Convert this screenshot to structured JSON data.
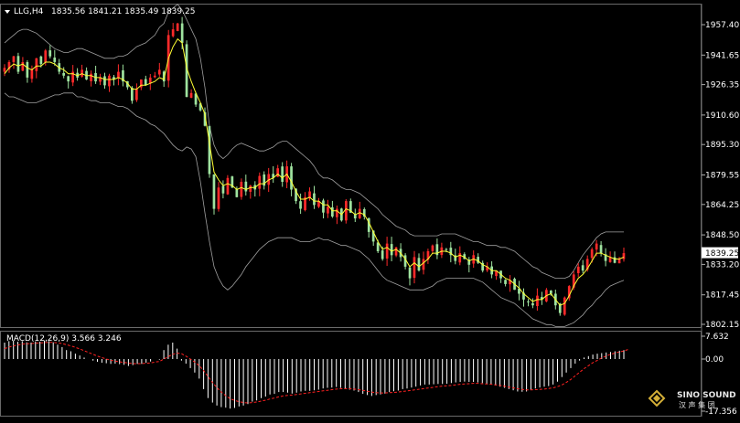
{
  "header": {
    "symbol": "LLG,H4",
    "ohlc": "1835.56 1841.21 1835.49 1839.25"
  },
  "macd_header": "MACD(12,26,9) 3.566 3.246",
  "watermark": {
    "brand": "SINO SOUND",
    "sub": "汉 声 集 团"
  },
  "colors": {
    "background": "#000000",
    "up_candle": "#ff2a2a",
    "down_candle": "#9fe39f",
    "ma_line": "#ffff33",
    "bollinger": "#a0a0a0",
    "macd_hist": "#ffffff",
    "signal_line": "#ff2020",
    "price_tag_bg": "#ffffff"
  },
  "chart_data": [
    {
      "type": "candlestick",
      "title": "LLG,H4",
      "ylim": [
        1802.15,
        1965
      ],
      "y_ticks": [
        "1957.40",
        "1941.65",
        "1926.35",
        "1910.60",
        "1895.30",
        "1879.55",
        "1864.25",
        "1848.50",
        "1833.20",
        "1817.45",
        "1802.15"
      ],
      "tick_values": [
        1957.4,
        1941.65,
        1926.35,
        1910.6,
        1895.3,
        1879.55,
        1864.25,
        1848.5,
        1833.2,
        1817.45,
        1802.15
      ],
      "current_price_label": "1839.25",
      "current_price": 1839.25,
      "close": [
        1935,
        1938,
        1941,
        1933,
        1938,
        1930,
        1934,
        1940,
        1937,
        1944,
        1941,
        1938,
        1933,
        1931,
        1928,
        1933,
        1930,
        1934,
        1929,
        1932,
        1928,
        1930,
        1926,
        1931,
        1929,
        1933,
        1928,
        1925,
        1918,
        1924,
        1929,
        1926,
        1930,
        1931,
        1934,
        1928,
        1952,
        1955,
        1958,
        1948,
        1920,
        1922,
        1916,
        1913,
        1905,
        1880,
        1862,
        1873,
        1870,
        1878,
        1873,
        1868,
        1876,
        1871,
        1874,
        1872,
        1879,
        1874,
        1880,
        1878,
        1883,
        1876,
        1884,
        1872,
        1866,
        1862,
        1868,
        1871,
        1864,
        1866,
        1860,
        1863,
        1858,
        1862,
        1856,
        1866,
        1860,
        1857,
        1862,
        1858,
        1850,
        1845,
        1840,
        1836,
        1844,
        1838,
        1842,
        1837,
        1832,
        1826,
        1837,
        1830,
        1836,
        1840,
        1843,
        1838,
        1842,
        1841,
        1838,
        1835,
        1839,
        1836,
        1833,
        1838,
        1834,
        1830,
        1832,
        1828,
        1830,
        1826,
        1823,
        1825,
        1820,
        1818,
        1815,
        1814,
        1812,
        1817,
        1815,
        1820,
        1818,
        1812,
        1808,
        1816,
        1822,
        1828,
        1832,
        1830,
        1836,
        1841,
        1844,
        1839,
        1835,
        1837,
        1834,
        1836,
        1839
      ],
      "ma_line": [
        1932,
        1935,
        1937,
        1936,
        1937,
        1935,
        1934,
        1936,
        1936,
        1938,
        1938,
        1937,
        1935,
        1934,
        1932,
        1932,
        1931,
        1932,
        1931,
        1931,
        1930,
        1930,
        1929,
        1929,
        1929,
        1930,
        1929,
        1927,
        1924,
        1924,
        1926,
        1926,
        1927,
        1928,
        1930,
        1929,
        1940,
        1946,
        1950,
        1948,
        1935,
        1928,
        1922,
        1917,
        1911,
        1896,
        1881,
        1877,
        1874,
        1875,
        1874,
        1872,
        1873,
        1872,
        1873,
        1873,
        1875,
        1875,
        1877,
        1878,
        1880,
        1878,
        1880,
        1876,
        1871,
        1867,
        1867,
        1868,
        1866,
        1866,
        1864,
        1864,
        1861,
        1861,
        1859,
        1862,
        1861,
        1859,
        1860,
        1859,
        1855,
        1850,
        1845,
        1841,
        1842,
        1840,
        1841,
        1839,
        1836,
        1832,
        1834,
        1832,
        1834,
        1836,
        1839,
        1839,
        1840,
        1840,
        1839,
        1837,
        1838,
        1837,
        1835,
        1836,
        1835,
        1833,
        1832,
        1830,
        1830,
        1828,
        1826,
        1825,
        1823,
        1821,
        1818,
        1816,
        1814,
        1815,
        1815,
        1817,
        1818,
        1815,
        1812,
        1813,
        1817,
        1822,
        1826,
        1828,
        1831,
        1835,
        1839,
        1839,
        1838,
        1837,
        1836,
        1836,
        1837
      ],
      "bb_upper": [
        1948,
        1950,
        1952,
        1954,
        1955,
        1955,
        1954,
        1953,
        1951,
        1949,
        1947,
        1945,
        1944,
        1943,
        1943,
        1944,
        1945,
        1945,
        1944,
        1943,
        1942,
        1941,
        1940,
        1940,
        1940,
        1941,
        1941,
        1942,
        1944,
        1946,
        1947,
        1948,
        1950,
        1952,
        1956,
        1958,
        1964,
        1966,
        1968,
        1965,
        1960,
        1955,
        1950,
        1940,
        1925,
        1905,
        1895,
        1890,
        1888,
        1890,
        1893,
        1895,
        1896,
        1895,
        1894,
        1893,
        1892,
        1892,
        1893,
        1894,
        1896,
        1897,
        1897,
        1895,
        1893,
        1891,
        1889,
        1887,
        1884,
        1880,
        1878,
        1878,
        1877,
        1875,
        1873,
        1872,
        1872,
        1871,
        1870,
        1868,
        1866,
        1864,
        1862,
        1859,
        1857,
        1855,
        1853,
        1852,
        1851,
        1849,
        1848,
        1848,
        1848,
        1848,
        1848,
        1848,
        1849,
        1849,
        1849,
        1849,
        1848,
        1847,
        1846,
        1845,
        1845,
        1844,
        1843,
        1843,
        1843,
        1842,
        1842,
        1841,
        1840,
        1838,
        1836,
        1834,
        1832,
        1831,
        1829,
        1828,
        1827,
        1826,
        1826,
        1826,
        1827,
        1830,
        1834,
        1838,
        1841,
        1844,
        1847,
        1849,
        1850,
        1850,
        1850,
        1850,
        1850
      ],
      "bb_lower": [
        1922,
        1920,
        1920,
        1919,
        1918,
        1917,
        1917,
        1917,
        1918,
        1919,
        1920,
        1921,
        1921,
        1922,
        1922,
        1922,
        1920,
        1920,
        1919,
        1918,
        1918,
        1917,
        1917,
        1917,
        1916,
        1915,
        1915,
        1914,
        1912,
        1910,
        1909,
        1908,
        1906,
        1905,
        1903,
        1901,
        1898,
        1895,
        1893,
        1892,
        1894,
        1893,
        1889,
        1876,
        1860,
        1845,
        1832,
        1826,
        1822,
        1820,
        1822,
        1825,
        1828,
        1832,
        1835,
        1838,
        1841,
        1843,
        1845,
        1846,
        1847,
        1847,
        1847,
        1847,
        1846,
        1845,
        1845,
        1845,
        1846,
        1847,
        1846,
        1846,
        1845,
        1844,
        1843,
        1843,
        1842,
        1841,
        1840,
        1838,
        1836,
        1833,
        1830,
        1827,
        1825,
        1824,
        1823,
        1822,
        1821,
        1820,
        1820,
        1820,
        1820,
        1821,
        1822,
        1824,
        1825,
        1826,
        1826,
        1826,
        1826,
        1826,
        1826,
        1826,
        1825,
        1824,
        1822,
        1820,
        1818,
        1816,
        1815,
        1814,
        1813,
        1811,
        1809,
        1807,
        1805,
        1804,
        1803,
        1802,
        1802,
        1801,
        1801,
        1801,
        1802,
        1803,
        1805,
        1807,
        1810,
        1812,
        1815,
        1817,
        1820,
        1822,
        1823,
        1824,
        1825
      ]
    },
    {
      "type": "bar",
      "title": "MACD(12,26,9) 3.566 3.246",
      "ylim": [
        -17.356,
        7.632
      ],
      "y_ticks": [
        "7.632",
        "0.00",
        "-17.356"
      ],
      "tick_values": [
        7.632,
        0.0,
        -17.356
      ],
      "histogram": [
        5.5,
        6.0,
        6.2,
        5.8,
        6.0,
        5.6,
        5.5,
        5.9,
        5.8,
        6.2,
        6.0,
        5.6,
        4.8,
        4.0,
        3.0,
        2.6,
        1.8,
        1.2,
        0.5,
        0.0,
        -0.5,
        -0.9,
        -1.2,
        -1.4,
        -1.6,
        -1.5,
        -1.7,
        -1.9,
        -2.3,
        -2.0,
        -1.6,
        -1.6,
        -1.2,
        -0.8,
        0.0,
        -0.2,
        3.0,
        4.8,
        5.5,
        3.5,
        -0.5,
        -1.5,
        -3.0,
        -4.5,
        -6.5,
        -10,
        -13,
        -14.5,
        -15.5,
        -16.0,
        -16.2,
        -16.5,
        -16.3,
        -15.8,
        -15.5,
        -15.0,
        -14.2,
        -13.8,
        -13.0,
        -12.5,
        -11.8,
        -11.6,
        -11.0,
        -11.0,
        -11.2,
        -11.5,
        -11.2,
        -10.8,
        -10.6,
        -10.6,
        -10.4,
        -10.2,
        -9.8,
        -9.6,
        -9.5,
        -9.3,
        -9.6,
        -10.0,
        -10.2,
        -10.5,
        -11.0,
        -11.6,
        -12.0,
        -12.3,
        -12.0,
        -11.8,
        -11.5,
        -11.0,
        -10.7,
        -10.5,
        -10.0,
        -9.8,
        -9.5,
        -9.2,
        -8.8,
        -8.5,
        -8.5,
        -8.4,
        -8.3,
        -8.3,
        -8.2,
        -8.0,
        -7.8,
        -7.6,
        -7.5,
        -7.6,
        -7.6,
        -7.8,
        -8.0,
        -8.2,
        -8.5,
        -8.8,
        -9.2,
        -9.6,
        -10.0,
        -10.4,
        -10.8,
        -10.9,
        -10.8,
        -10.3,
        -9.8,
        -9.5,
        -9.2,
        -9.0,
        -8.5,
        -7.5,
        -6.0,
        -4.5,
        -3.0,
        -1.5,
        -0.5,
        0.5,
        1.0,
        1.5,
        1.8,
        2.0,
        2.2,
        2.4,
        2.6,
        2.8,
        3.0
      ],
      "signal": [
        3.5,
        4.0,
        4.4,
        4.7,
        5.0,
        5.1,
        5.2,
        5.3,
        5.4,
        5.5,
        5.6,
        5.6,
        5.4,
        5.2,
        4.8,
        4.4,
        3.9,
        3.4,
        2.8,
        2.2,
        1.6,
        1.0,
        0.5,
        0.0,
        -0.4,
        -0.7,
        -0.9,
        -1.1,
        -1.3,
        -1.5,
        -1.5,
        -1.5,
        -1.4,
        -1.3,
        -1.0,
        -0.8,
        0.0,
        0.8,
        1.6,
        2.0,
        1.8,
        1.0,
        0.0,
        -1.0,
        -2.2,
        -3.8,
        -5.8,
        -7.8,
        -9.5,
        -11.0,
        -12.2,
        -13.2,
        -13.8,
        -14.2,
        -14.5,
        -14.6,
        -14.5,
        -14.3,
        -14.0,
        -13.7,
        -13.3,
        -13.0,
        -12.6,
        -12.3,
        -12.1,
        -12.0,
        -11.8,
        -11.6,
        -11.4,
        -11.2,
        -11.0,
        -10.8,
        -10.6,
        -10.4,
        -10.2,
        -10.0,
        -9.9,
        -9.9,
        -9.9,
        -10.0,
        -10.2,
        -10.4,
        -10.7,
        -11.0,
        -11.2,
        -11.3,
        -11.3,
        -11.2,
        -11.1,
        -11.0,
        -10.8,
        -10.6,
        -10.4,
        -10.2,
        -10.0,
        -9.8,
        -9.6,
        -9.4,
        -9.2,
        -9.0,
        -8.9,
        -8.8,
        -8.6,
        -8.4,
        -8.3,
        -8.2,
        -8.1,
        -8.1,
        -8.2,
        -8.3,
        -8.4,
        -8.6,
        -8.8,
        -9.0,
        -9.3,
        -9.6,
        -9.9,
        -10.1,
        -10.3,
        -10.3,
        -10.2,
        -10.1,
        -10.0,
        -9.8,
        -9.6,
        -9.2,
        -8.6,
        -7.8,
        -6.8,
        -5.6,
        -4.4,
        -3.2,
        -2.2,
        -1.2,
        -0.4,
        0.4,
        1.0,
        1.6,
        2.0,
        2.4,
        2.7,
        3.2
      ]
    }
  ]
}
